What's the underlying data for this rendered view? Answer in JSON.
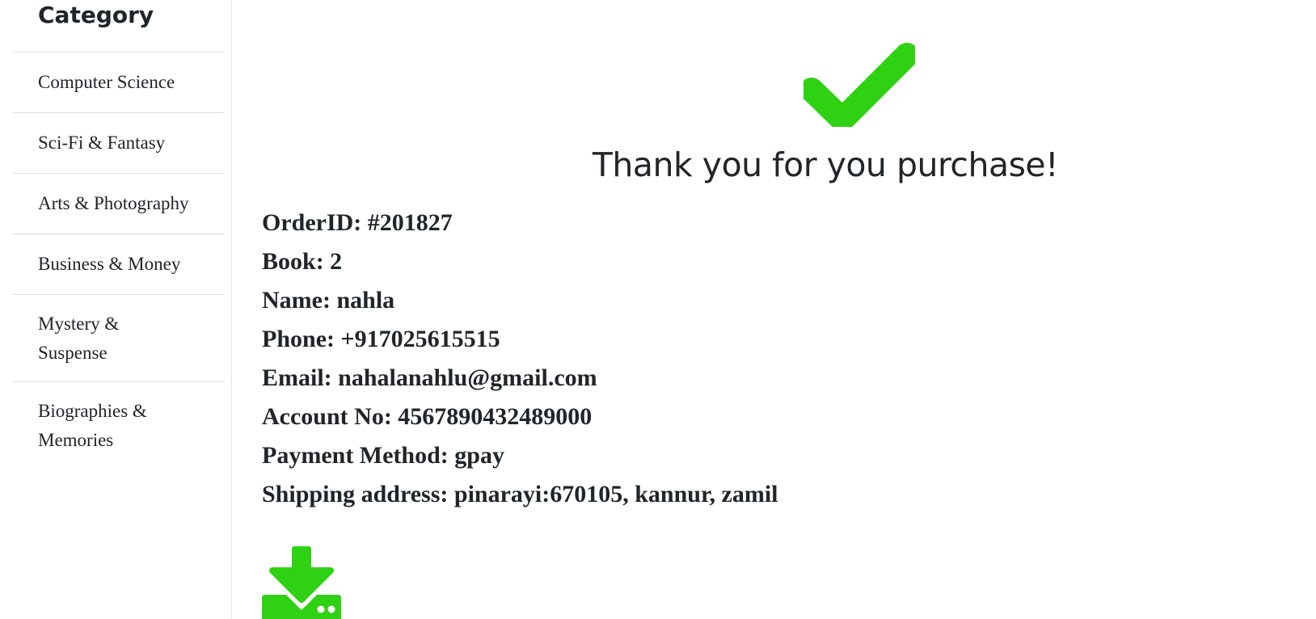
{
  "sidebar": {
    "heading": "Category",
    "items": [
      {
        "label": "Computer Science"
      },
      {
        "label": "Sci-Fi & Fantasy"
      },
      {
        "label": "Arts & Photography"
      },
      {
        "label": "Business & Money"
      },
      {
        "label": "Mystery & Suspense"
      },
      {
        "label": "Biographies & Memories"
      }
    ]
  },
  "confirmation": {
    "icon": "check-icon",
    "icon_color": "#2fd212",
    "title": "Thank you for you purchase!"
  },
  "order": {
    "lines": [
      "OrderID: #201827",
      "Book: 2",
      "Name: nahla",
      "Phone: +917025615515",
      "Email: nahalanahlu@gmail.com",
      "Account No: 4567890432489000",
      "Payment Method: gpay",
      "Shipping address: pinarayi:670105, kannur, zamil"
    ]
  },
  "download": {
    "icon": "download-icon",
    "icon_color": "#2fd212"
  }
}
